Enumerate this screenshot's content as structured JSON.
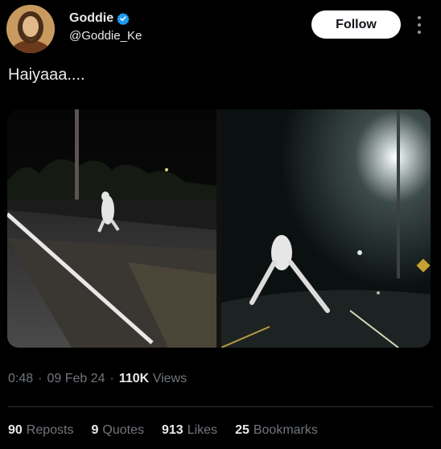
{
  "user": {
    "name": "Goddie",
    "handle": "@Goddie_Ke"
  },
  "follow_label": "Follow",
  "tweet": {
    "text": "Haiyaaa...."
  },
  "meta": {
    "time": "0:48",
    "sep1": "·",
    "date": "09 Feb 24",
    "sep2": "·",
    "views_count": "110K",
    "views_label": "Views"
  },
  "stats": {
    "reposts": {
      "count": "90",
      "label": "Reposts"
    },
    "quotes": {
      "count": "9",
      "label": "Quotes"
    },
    "likes": {
      "count": "913",
      "label": "Likes"
    },
    "bookmarks": {
      "count": "25",
      "label": "Bookmarks"
    }
  },
  "colors": {
    "background": "#000000",
    "text": "#e7e9ea",
    "muted": "#71767b",
    "verified": "#1d9bf0",
    "follow_bg": "#ffffff"
  },
  "icons": {
    "verified": "verified-badge-icon",
    "more": "more-options-icon"
  }
}
